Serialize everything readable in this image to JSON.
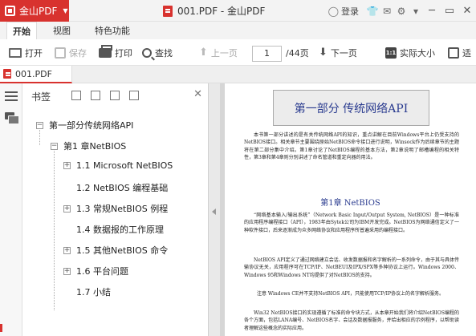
{
  "titlebar": {
    "app_name": "金山PDF",
    "document_title": "001.PDF - 金山PDF",
    "login_label": "登录",
    "accent_color": "#d8322e"
  },
  "ribbon": {
    "tabs": [
      {
        "label": "开始",
        "active": true
      },
      {
        "label": "视图",
        "active": false
      },
      {
        "label": "特色功能",
        "active": false
      }
    ]
  },
  "toolbar": {
    "open_label": "打开",
    "save_label": "保存",
    "print_label": "打印",
    "find_label": "查找",
    "prev_label": "上一页",
    "page_value": "1",
    "page_total": "/44页",
    "next_label": "下一页",
    "actual_size_label": "实际大小",
    "fit_label": "适"
  },
  "document_tab": {
    "label": "001.PDF"
  },
  "bookmarks": {
    "title": "书签",
    "items": [
      {
        "label": "第一部分传统网络API",
        "toggle": "−"
      },
      {
        "label": "第1 章NetBIOS",
        "toggle": "−"
      },
      {
        "label": "1.1 Microsoft NetBIOS",
        "toggle": "+"
      },
      {
        "label": "1.2 NetBIOS 编程基础",
        "toggle": ""
      },
      {
        "label": "1.3 常规NetBIOS 例程",
        "toggle": "+"
      },
      {
        "label": "1.4 数据报的工作原理",
        "toggle": ""
      },
      {
        "label": "1.5 其他NetBIOS 命令",
        "toggle": "+"
      },
      {
        "label": "1.6 平台问题",
        "toggle": "+"
      },
      {
        "label": "1.7 小结",
        "toggle": ""
      }
    ]
  },
  "page": {
    "heading": "第一部分  传统网络API",
    "intro": "本书第一部分讲述的是有关传统网络API的知识，重点讲解在目前Windows平台上仍受支持的NetBIOS接口。相关章节主要围绕原始NetBIOS命令接口进行说明，Winsock作为后续章节的主题将在第二部分集中介绍。第1章讨论了NetBIOS编程的基本方法，第2章说明了邮槽编程的相关特性，第3章和第4章则分别讲述了命名管道和重定向器的用法。",
    "chapter_title": "第1章  NetBIOS",
    "body1": "“网络基本输入/输出系统”（Network Basic Input/Output System, NetBIOS）是一种标准的应用程序编程接口（API），1983年由Sytek公司为IBM开发完成。NetBIOS为网络通信定义了一种软件接口，后来逐渐成为众多网络协议和应用程序所普遍采用的编程接口。",
    "body2": "NetBIOS API定义了通过网络建立会话、收发数据报和名字解析的一系列命令，由于其与具体传输协议无关，应用程序可在TCP/IP、NetBEUI及IPX/SPX等多种协议上运行。Windows 2000、Windows 95和Windows NT均提供了对NetBIOS的支持。",
    "note": "注意  Windows CE并不支持NetBIOS API，只能使用TCP/IP协议上的名字解析服务。",
    "body3": "Win32 NetBIOS接口的实现遵循了标准的命令块方式，从本章开始我们将介绍NetBIOS编程的各个方面，包括LANA编号、NetBIOS名字、会话及数据报服务，并给出相应的示例程序，以帮助读者理解这些概念的实际应用。"
  }
}
